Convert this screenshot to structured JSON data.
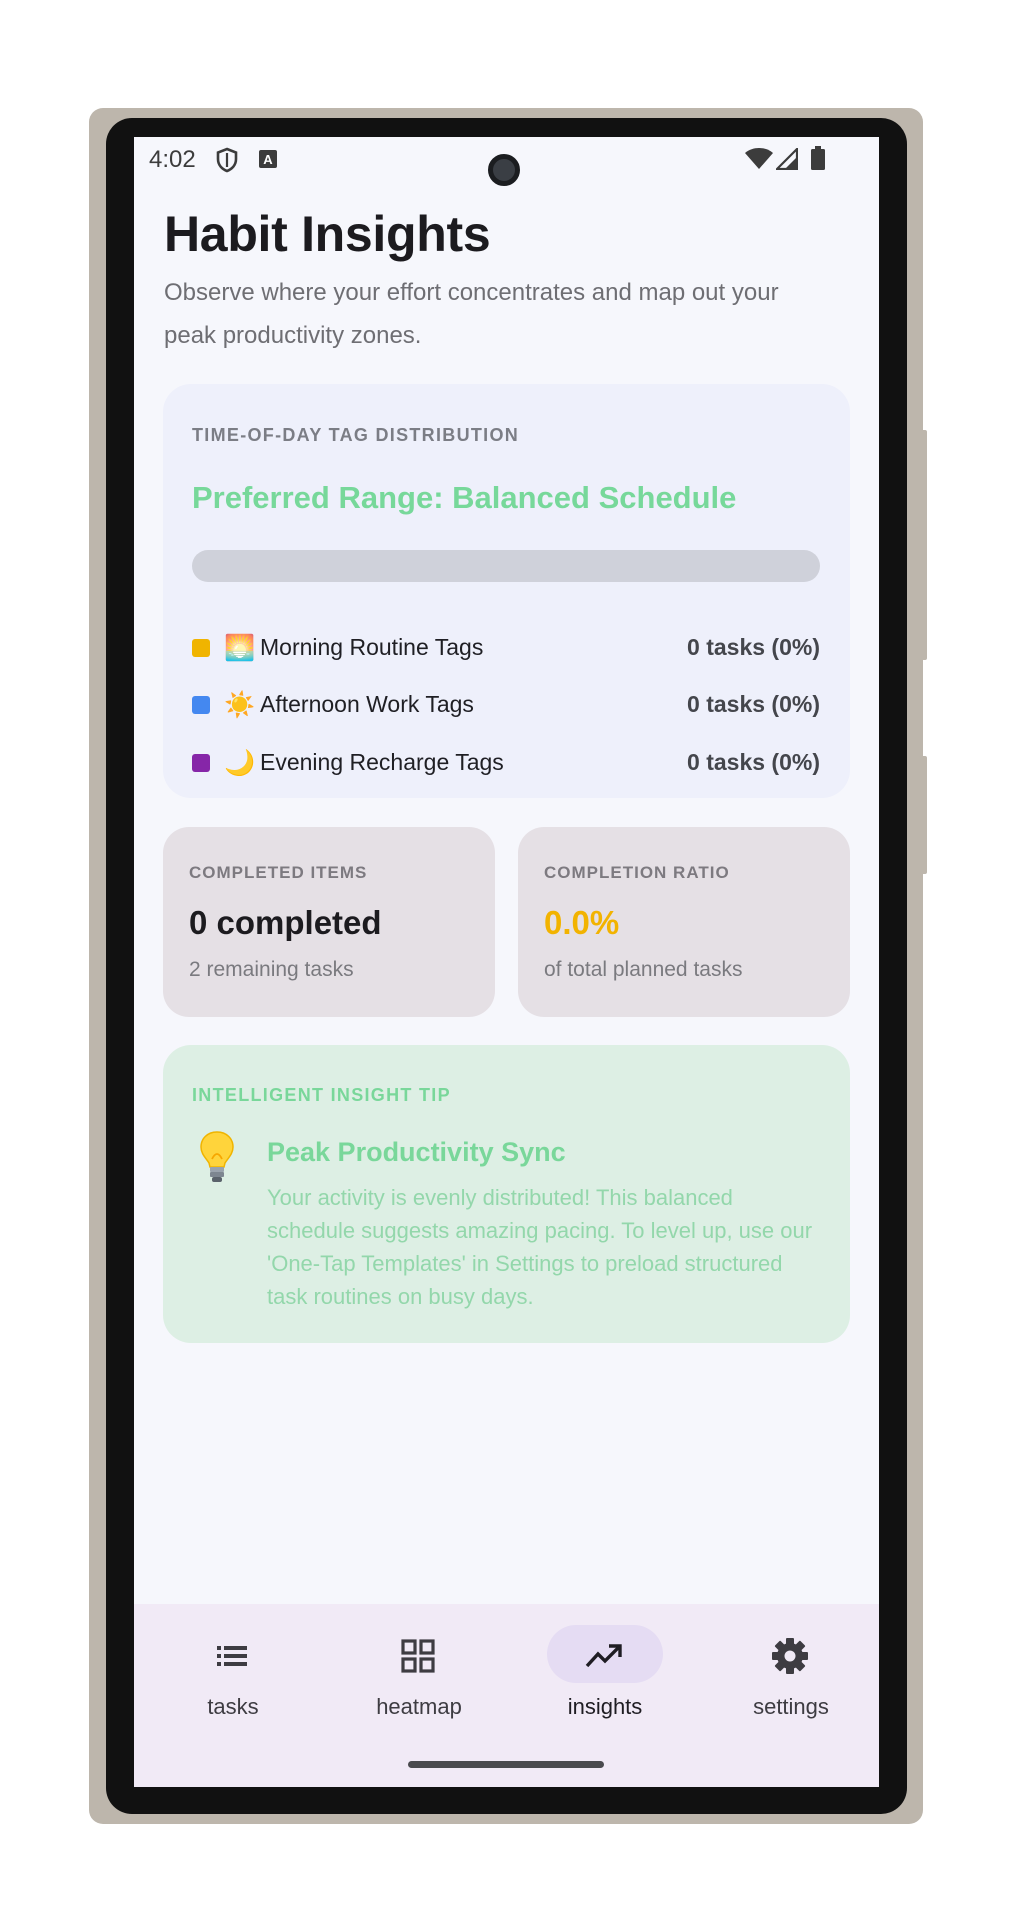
{
  "status_bar": {
    "time": "4:02",
    "left_icons": [
      "shield-icon",
      "keyboard-a-icon"
    ],
    "right_icons": [
      "wifi-icon",
      "signal-icon",
      "battery-icon"
    ]
  },
  "header": {
    "title": "Habit Insights",
    "subtitle": "Observe where your effort concentrates and map out your peak productivity zones."
  },
  "distribution": {
    "caption": "TIME-OF-DAY TAG DISTRIBUTION",
    "preferred_range": "Preferred Range: Balanced Schedule",
    "progress_fraction": 0,
    "rows": [
      {
        "swatch_color": "#f0b400",
        "emoji": "🌅",
        "label": "Morning Routine Tags",
        "value": "0 tasks (0%)"
      },
      {
        "swatch_color": "#4488f0",
        "emoji": "☀️",
        "label": "Afternoon Work Tags",
        "value": "0 tasks (0%)"
      },
      {
        "swatch_color": "#8626a8",
        "emoji": "🌙",
        "label": "Evening Recharge Tags",
        "value": "0 tasks (0%)"
      }
    ]
  },
  "stats": {
    "completed": {
      "caption": "COMPLETED ITEMS",
      "value": "0 completed",
      "sub": "2 remaining tasks"
    },
    "ratio": {
      "caption": "COMPLETION RATIO",
      "value": "0.0%",
      "sub": "of total planned tasks",
      "value_color": "#f2b300"
    }
  },
  "tip": {
    "caption": "INTELLIGENT INSIGHT TIP",
    "icon": "lightbulb-icon",
    "title": "Peak Productivity Sync",
    "body": "Your activity is evenly distributed! This balanced schedule suggests amazing pacing. To level up, use our 'One-Tap Templates' in Settings to preload structured task routines on busy days."
  },
  "bottom_nav": {
    "items": [
      {
        "label": "tasks",
        "icon": "list-icon",
        "active": false
      },
      {
        "label": "heatmap",
        "icon": "grid-icon",
        "active": false
      },
      {
        "label": "insights",
        "icon": "trending-up-icon",
        "active": true
      },
      {
        "label": "settings",
        "icon": "gear-icon",
        "active": false
      }
    ]
  },
  "colors": {
    "accent_green": "#77d89a",
    "accent_orange": "#f2b300",
    "active_nav_pill": "#e5dcf3"
  }
}
